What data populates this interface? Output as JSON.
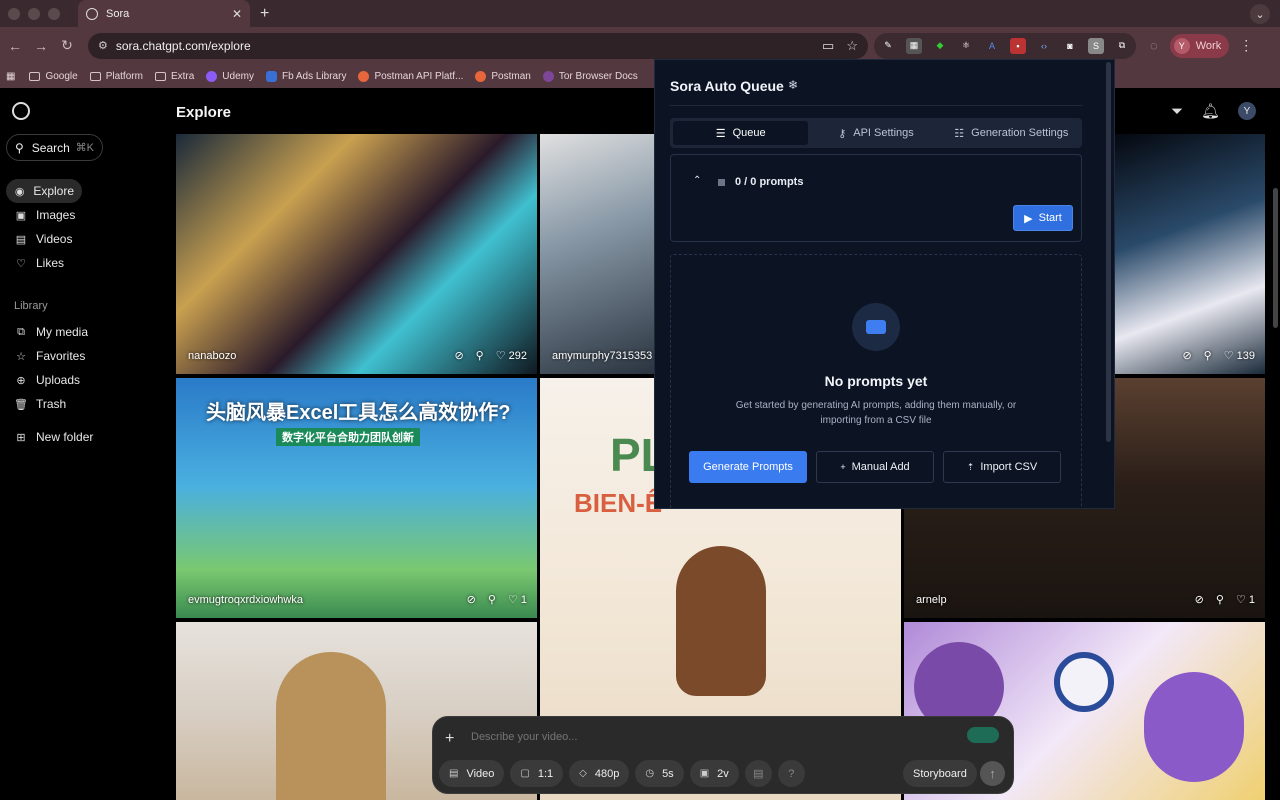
{
  "browser": {
    "tab_title": "Sora",
    "url": "sora.chatgpt.com/explore",
    "profile_initial": "Y",
    "profile_label": "Work",
    "bookmarks": [
      "Google",
      "Platform",
      "Extra",
      "Udemy",
      "Fb Ads Library",
      "Postman API Platf...",
      "Postman",
      "Tor Browser Docs"
    ]
  },
  "sidebar": {
    "search_label": "Search",
    "search_shortcut": "⌘K",
    "nav": [
      "Explore",
      "Images",
      "Videos",
      "Likes"
    ],
    "library_label": "Library",
    "library": [
      "My media",
      "Favorites",
      "Uploads",
      "Trash"
    ],
    "new_folder": "New folder"
  },
  "header": {
    "title": "Explore",
    "avatar_initial": "Y"
  },
  "feed": {
    "tile1": {
      "user": "nanabozo",
      "likes": "292"
    },
    "tile2": {
      "user": "amymurphy7315353"
    },
    "tile3": {
      "likes": "139"
    },
    "tile4": {
      "user": "evmugtroqxrdxiowhwka",
      "likes": "1",
      "headline": "头脑风暴Excel工具怎么高效协作?",
      "subhead": "数字化平台合助力团队创新"
    },
    "tile5": {
      "headline": "PL",
      "subhead": "BIEN-Ê"
    },
    "tile6": {
      "user": "arnelp",
      "likes": "1"
    }
  },
  "composer": {
    "placeholder": "Describe your video...",
    "type": "Video",
    "ratio": "1:1",
    "quality": "480p",
    "duration": "5s",
    "variations": "2v",
    "help": "?",
    "storyboard": "Storyboard"
  },
  "extension": {
    "title": "Sora Auto Queue",
    "tabs": [
      "Queue",
      "API Settings",
      "Generation Settings"
    ],
    "queue_count": "0 / 0 prompts",
    "start": "Start",
    "empty_title": "No prompts yet",
    "empty_desc": "Get started by generating AI prompts, adding them manually, or importing from a CSV file",
    "generate": "Generate Prompts",
    "manual_add": "Manual Add",
    "import_csv": "Import CSV"
  },
  "colors": {
    "accent_blue": "#3a7bef",
    "panel_bg": "#0c1322",
    "chrome": "#53383f"
  }
}
